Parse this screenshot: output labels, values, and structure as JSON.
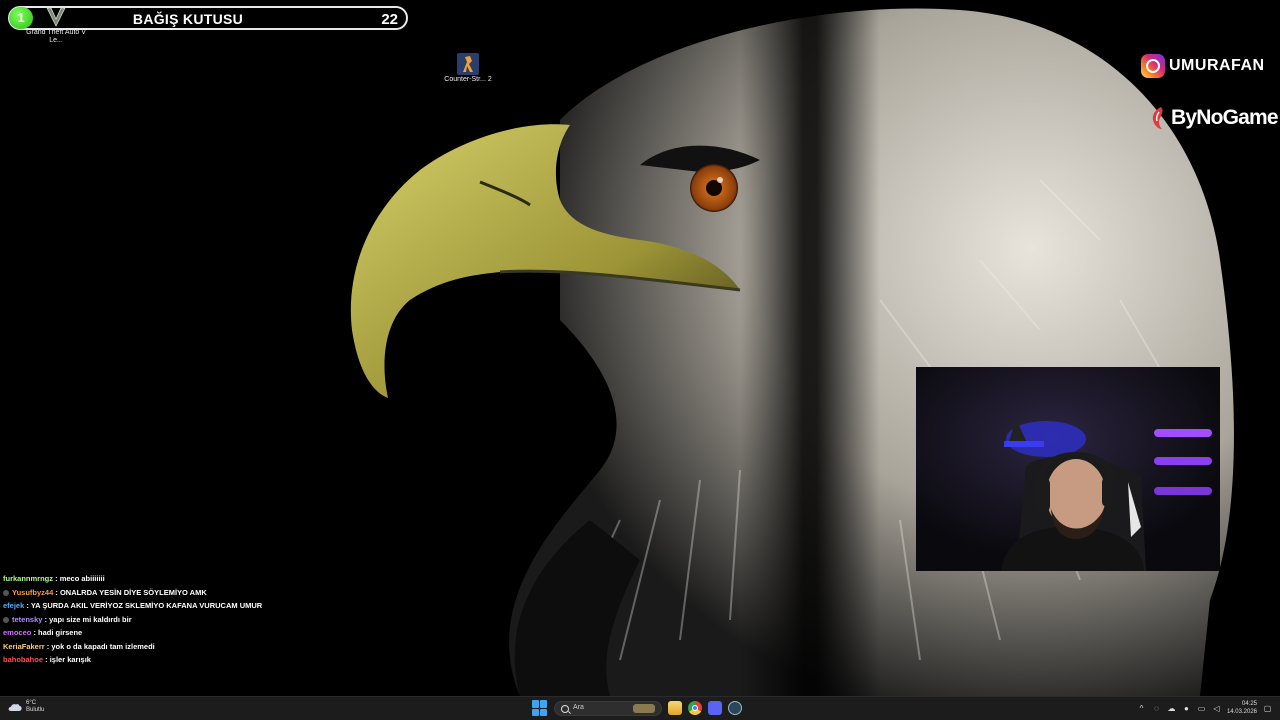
{
  "donation_box": {
    "badge_count": "1",
    "title": "BAĞIŞ KUTUSU",
    "amount": "22"
  },
  "desktop_icons": [
    {
      "label": "Grand Theft Auto V Le...",
      "icon": "gta-v-icon"
    },
    {
      "label": "Counter-Str... 2",
      "icon": "counter-strike-icon"
    }
  ],
  "branding": {
    "instagram_handle": "UMURAFAN",
    "sponsor": "ByNoGame"
  },
  "chat": [
    {
      "user": "furkannmrngz",
      "color": "#a6ff8a",
      "message": "meco abiiiiiii",
      "badge": false
    },
    {
      "user": "Yusufbyz44",
      "color": "#ff9a3c",
      "message": "ONALRDA YESİN DİYE SÖYLEMİYO AMK",
      "badge": true
    },
    {
      "user": "efejek",
      "color": "#4db0ff",
      "message": "YA ŞURDA AKIL VERİYOZ SKLEMİYO KAFANA VURUCAM UMUR",
      "badge": false
    },
    {
      "user": "tetensky",
      "color": "#b48cff",
      "message": "yapı size mi kaldırdı bir",
      "badge": true
    },
    {
      "user": "emoceo",
      "color": "#d86bff",
      "message": "hadi girsene",
      "badge": false
    },
    {
      "user": "KeriaFakerr",
      "color": "#ffcf6b",
      "message": "yok o da kapadı tam izlemedi",
      "badge": false
    },
    {
      "user": "bahobahoe",
      "color": "#ff4f5a",
      "message": "işler karışık",
      "badge": false
    }
  ],
  "taskbar": {
    "weather_temp": "6°C",
    "weather_desc": "Bulutlu",
    "search_placeholder": "Ara",
    "time": "04:25",
    "date": "14.03.2026"
  },
  "colors": {
    "donation_badge": "#2bbd14",
    "taskbar_bg": "#1c1c1c",
    "accent_blue": "#3fa4f0"
  }
}
